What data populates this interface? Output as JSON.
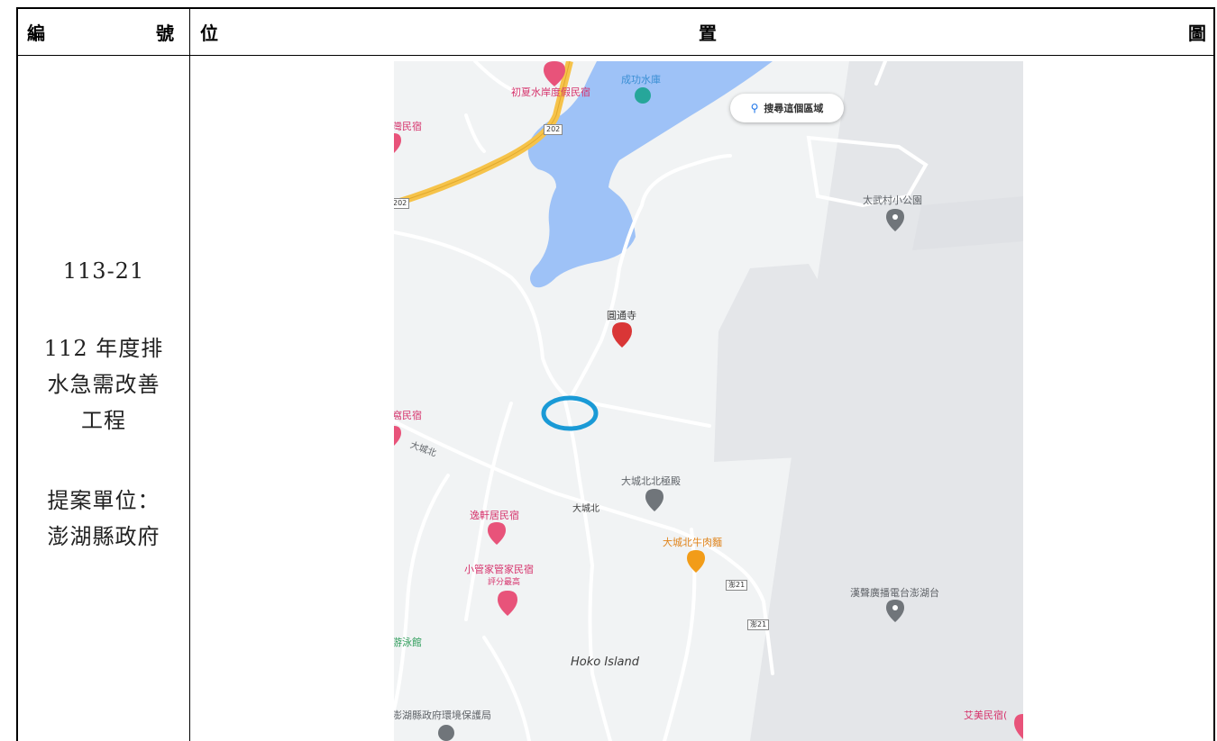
{
  "header": {
    "col1_left": "編",
    "col1_right": "號",
    "col2_left": "位",
    "col2_mid": "置",
    "col2_right": "圖"
  },
  "project": {
    "number": "113-21",
    "name_line1": "112 年度排",
    "name_line2": "水急需改善",
    "name_line3": "工程",
    "unit_line1": "提案單位：",
    "unit_line2": "澎湖縣政府"
  },
  "map": {
    "search_button": "搜尋這個區域",
    "labels": {
      "reservoir": "成功水庫",
      "hotel1": "初夏水岸度假民宿",
      "hotel_left_top": "灣民宿",
      "park": "太武村小公園",
      "temple": "圓通寺",
      "hotel_left_mid": "窩民宿",
      "road_datcheng_a": "大城北",
      "palace": "大城北北極殿",
      "road_datcheng_b": "大城北",
      "hotel_yixuan": "逸軒居民宿",
      "noodle": "大城北牛肉麵",
      "hotel_xiaoguan": "小管家管家民宿",
      "rating": "評分最高",
      "radio": "漢聲廣播電台澎湖台",
      "pool": "游泳館",
      "island": "Hoko Island",
      "epa": "澎湖縣政府環境保護局",
      "hotel_aimei": "艾美民宿("
    },
    "shields": {
      "s1": "202",
      "s2": "202",
      "s3": "澎21",
      "s4": "澎21"
    },
    "colors": {
      "water": "#9ec2f7",
      "highway": "#f6c34a",
      "runway": "#e4e6e9",
      "marker_circle": "#1a9ad6",
      "pink_pin": "#e8537a",
      "gray_pin": "#70757a",
      "temple_pin": "#d93636",
      "food_pin": "#f29c18"
    }
  }
}
